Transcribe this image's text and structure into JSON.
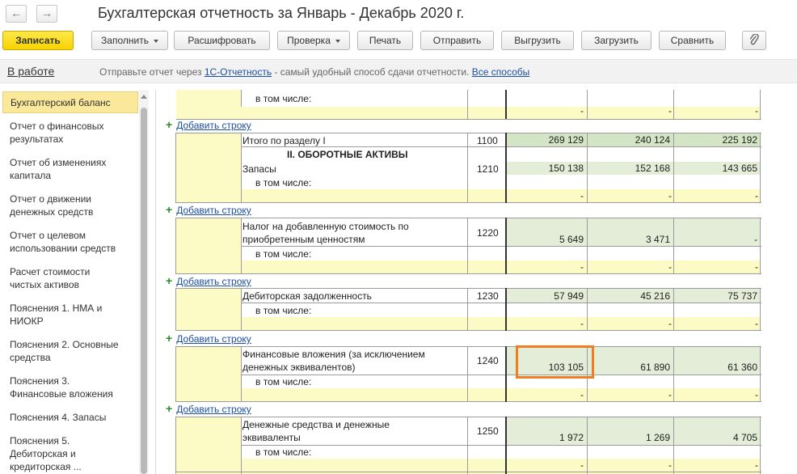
{
  "window": {
    "title": "Бухгалтерская отчетность за Январь - Декабрь 2020 г."
  },
  "toolbar": {
    "save": "Записать",
    "fill": "Заполнить",
    "decode": "Расшифровать",
    "check": "Проверка",
    "print": "Печать",
    "send": "Отправить",
    "export": "Выгрузить",
    "import": "Загрузить",
    "compare": "Сравнить"
  },
  "infobar": {
    "status": "В работе",
    "text_before": "Отправьте отчет через ",
    "link1": "1С-Отчетность",
    "text_middle": " - самый удобный способ сдачи отчетности. ",
    "link2": "Все способы"
  },
  "sidebar": {
    "items": [
      {
        "label": "Бухгалтерский баланс"
      },
      {
        "label": "Отчет о финансовых результатах"
      },
      {
        "label": "Отчет об изменениях капитала"
      },
      {
        "label": "Отчет о движении денежных средств"
      },
      {
        "label": "Отчет о целевом использовании средств"
      },
      {
        "label": "Расчет стоимости чистых активов"
      },
      {
        "label": "Пояснения 1. НМА и НИОКР"
      },
      {
        "label": "Пояснения 2. Основные средства"
      },
      {
        "label": "Пояснения 3. Финансовые вложения"
      },
      {
        "label": "Пояснения 4. Запасы"
      },
      {
        "label": "Пояснения 5. Дебиторская и кредиторская ..."
      }
    ]
  },
  "form": {
    "add_row": "Добавить строку",
    "in_that_number": "в том числе:",
    "dash": "-",
    "total_label": "Итого по разделу I",
    "total_code": "1100",
    "total_values": [
      "269 129",
      "240 124",
      "225 192"
    ],
    "section_header": "II. ОБОРОТНЫЕ АКТИВЫ",
    "rows": [
      {
        "label": "Запасы",
        "code": "1210",
        "values": [
          "150 138",
          "152 168",
          "143 665"
        ]
      },
      {
        "label": "Налог на добавленную стоимость по приобретенным ценностям",
        "code": "1220",
        "values": [
          "5 649",
          "3 471",
          "-"
        ]
      },
      {
        "label": "Дебиторская задолженность",
        "code": "1230",
        "values": [
          "57 949",
          "45 216",
          "75 737"
        ]
      },
      {
        "label": "Финансовые вложения (за исключением денежных эквивалентов)",
        "code": "1240",
        "values": [
          "103 105",
          "61 890",
          "61 360"
        ]
      },
      {
        "label": "Денежные средства и денежные эквиваленты",
        "code": "1250",
        "values": [
          "1 972",
          "1 269",
          "4 705"
        ]
      }
    ]
  },
  "icons": {
    "back": "arrow-left-icon",
    "forward": "arrow-right-icon",
    "attach": "paperclip-icon"
  },
  "colors": {
    "primary_button": "#f7d300",
    "highlight": "#ef7d22",
    "link": "#1c4fa1",
    "input_yellow": "#fdfbc5",
    "computed_green": "#e3edd7"
  }
}
